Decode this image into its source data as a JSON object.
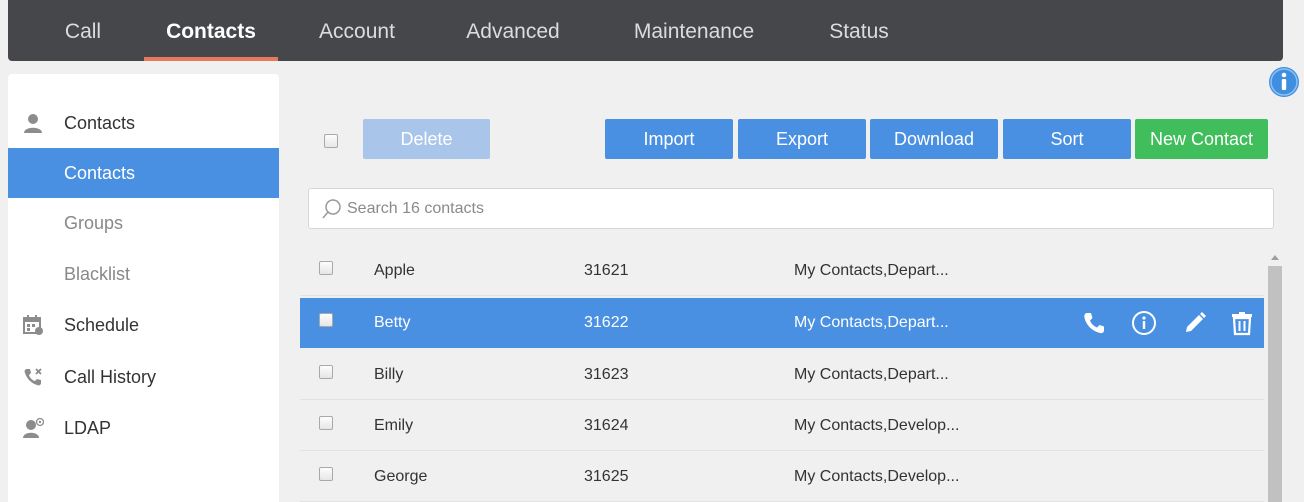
{
  "nav": {
    "tabs": [
      {
        "label": "Call"
      },
      {
        "label": "Contacts",
        "active": true
      },
      {
        "label": "Account"
      },
      {
        "label": "Advanced"
      },
      {
        "label": "Maintenance"
      },
      {
        "label": "Status"
      }
    ]
  },
  "sidebar": {
    "items": [
      {
        "label": "Contacts",
        "icon": "person-icon"
      },
      {
        "label": "Contacts",
        "selected": true
      },
      {
        "label": "Groups"
      },
      {
        "label": "Blacklist"
      },
      {
        "label": "Schedule",
        "icon": "calendar-icon"
      },
      {
        "label": "Call History",
        "icon": "call-history-icon"
      },
      {
        "label": "LDAP",
        "icon": "ldap-icon"
      }
    ]
  },
  "toolbar": {
    "delete_label": "Delete",
    "import_label": "Import",
    "export_label": "Export",
    "download_label": "Download",
    "sort_label": "Sort",
    "new_contact_label": "New Contact"
  },
  "search": {
    "placeholder": "Search 16 contacts",
    "value": ""
  },
  "contacts": [
    {
      "name": "Apple",
      "number": "31621",
      "groups": "My Contacts,Depart..."
    },
    {
      "name": "Betty",
      "number": "31622",
      "groups": "My Contacts,Depart...",
      "selected": true
    },
    {
      "name": "Billy",
      "number": "31623",
      "groups": "My Contacts,Depart..."
    },
    {
      "name": "Emily",
      "number": "31624",
      "groups": "My Contacts,Develop..."
    },
    {
      "name": "George",
      "number": "31625",
      "groups": "My Contacts,Develop..."
    }
  ],
  "colors": {
    "nav_bg": "#46474b",
    "accent": "#4a90e2",
    "active_underline": "#e8795a",
    "new_contact": "#3fbe5b",
    "delete_disabled": "#a9c6ea"
  }
}
